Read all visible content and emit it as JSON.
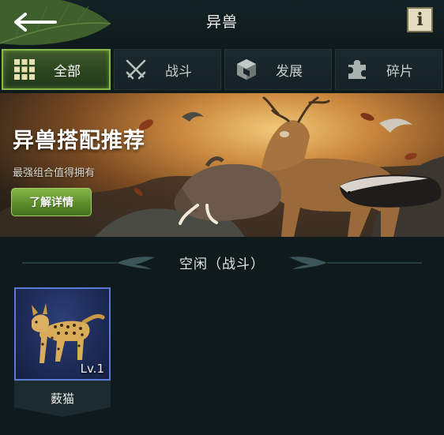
{
  "header": {
    "title": "异兽",
    "info_label": "i"
  },
  "tabs": [
    {
      "label": "全部",
      "icon": "grid-icon",
      "active": true
    },
    {
      "label": "战斗",
      "icon": "crossed-swords-icon",
      "active": false
    },
    {
      "label": "发展",
      "icon": "cube-icon",
      "active": false
    },
    {
      "label": "碎片",
      "icon": "puzzle-piece-icon",
      "active": false
    }
  ],
  "banner": {
    "title": "异兽搭配推荐",
    "subtitle": "最强组合值得拥有",
    "button_label": "了解详情"
  },
  "section": {
    "title": "空闲（战斗）"
  },
  "beasts": [
    {
      "name": "薮猫",
      "level": "Lv.1"
    }
  ],
  "colors": {
    "background": "#0f1a1c",
    "active_tab_border": "#88b84a",
    "card_border": "#5a7ad6",
    "button_green": "#5d8d2a"
  }
}
